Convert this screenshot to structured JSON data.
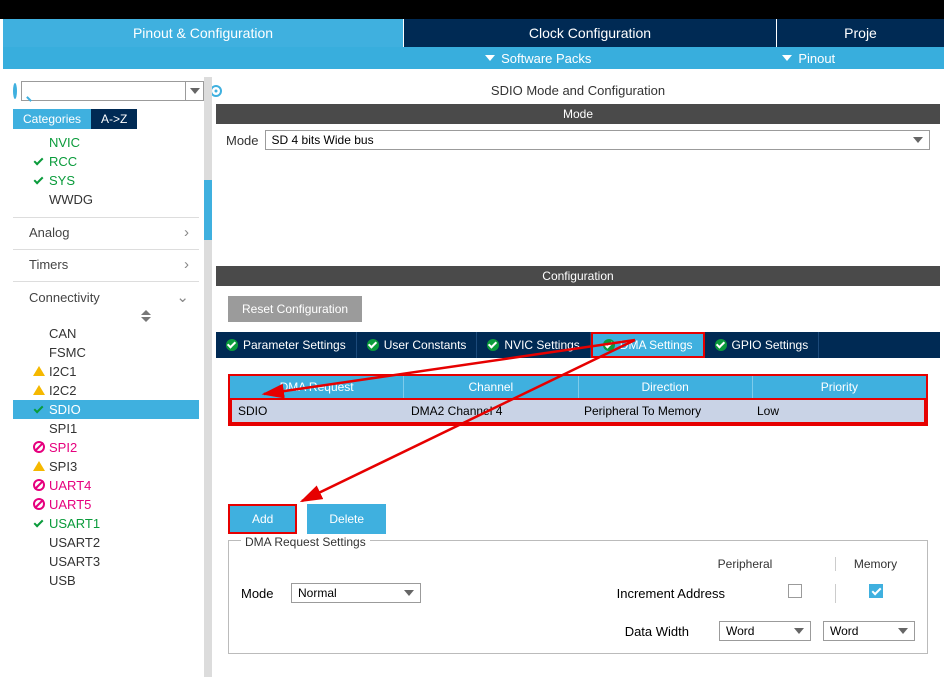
{
  "topTabs": {
    "pinout": "Pinout & Configuration",
    "clock": "Clock Configuration",
    "project": "Proje"
  },
  "subBar": {
    "software": "Software Packs",
    "pinout": "Pinout"
  },
  "search": {
    "placeholder": ""
  },
  "catTabs": {
    "categories": "Categories",
    "az": "A->Z"
  },
  "tree": {
    "items1": [
      {
        "label": "NVIC",
        "status": "none",
        "cls": "txt-green"
      },
      {
        "label": "RCC",
        "status": "check",
        "cls": "txt-green"
      },
      {
        "label": "SYS",
        "status": "check",
        "cls": "txt-green"
      },
      {
        "label": "WWDG",
        "status": "none",
        "cls": "txt-black"
      }
    ],
    "groups": [
      {
        "label": "Analog",
        "chev": "›"
      },
      {
        "label": "Timers",
        "chev": "›"
      },
      {
        "label": "Connectivity",
        "chev": "⌄"
      }
    ],
    "conn": [
      {
        "label": "CAN",
        "status": "none",
        "cls": "txt-black"
      },
      {
        "label": "FSMC",
        "status": "none",
        "cls": "txt-black"
      },
      {
        "label": "I2C1",
        "status": "warn",
        "cls": "txt-black"
      },
      {
        "label": "I2C2",
        "status": "warn",
        "cls": "txt-black"
      },
      {
        "label": "SDIO",
        "status": "check",
        "cls": "txt-green",
        "selected": true
      },
      {
        "label": "SPI1",
        "status": "none",
        "cls": "txt-black"
      },
      {
        "label": "SPI2",
        "status": "block",
        "cls": "txt-pink"
      },
      {
        "label": "SPI3",
        "status": "warn",
        "cls": "txt-black"
      },
      {
        "label": "UART4",
        "status": "block",
        "cls": "txt-pink"
      },
      {
        "label": "UART5",
        "status": "block",
        "cls": "txt-pink"
      },
      {
        "label": "USART1",
        "status": "check",
        "cls": "txt-green"
      },
      {
        "label": "USART2",
        "status": "none",
        "cls": "txt-black"
      },
      {
        "label": "USART3",
        "status": "none",
        "cls": "txt-black"
      },
      {
        "label": "USB",
        "status": "none",
        "cls": "txt-black"
      }
    ]
  },
  "center": {
    "title": "SDIO Mode and Configuration",
    "modeBar": "Mode",
    "modeLabel": "Mode",
    "modeValue": "SD 4 bits Wide bus",
    "confBar": "Configuration",
    "reset": "Reset Configuration",
    "tabs": {
      "param": "Parameter Settings",
      "user": "User Constants",
      "nvic": "NVIC Settings",
      "dma": "DMA Settings",
      "gpio": "GPIO Settings"
    },
    "dmaHead": {
      "req": "DMA Request",
      "ch": "Channel",
      "dir": "Direction",
      "pri": "Priority"
    },
    "dmaRow": {
      "req": "SDIO",
      "ch": "DMA2 Channel 4",
      "dir": "Peripheral To Memory",
      "pri": "Low"
    },
    "buttons": {
      "add": "Add",
      "delete": "Delete"
    },
    "reqSettings": {
      "title": "DMA Request Settings",
      "peripheral": "Peripheral",
      "memory": "Memory",
      "modeLabel": "Mode",
      "modeValue": "Normal",
      "incAddr": "Increment Address",
      "dataWidth": "Data Width",
      "wordA": "Word",
      "wordB": "Word"
    }
  }
}
